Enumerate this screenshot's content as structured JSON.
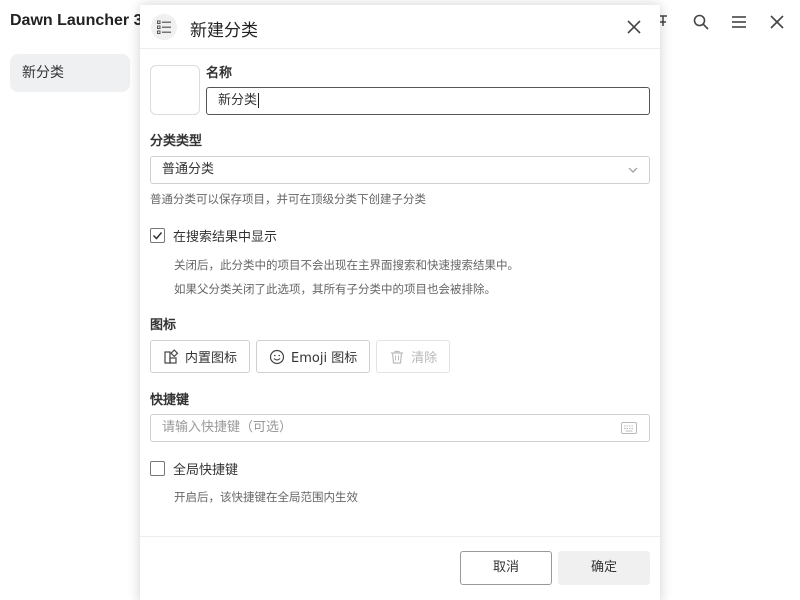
{
  "app": {
    "title": "Dawn Launcher 3",
    "sidebar_item": "新分类"
  },
  "dialog": {
    "title": "新建分类",
    "name_label": "名称",
    "name_value": "新分类",
    "type_label": "分类类型",
    "type_value": "普通分类",
    "type_help": "普通分类可以保存项目，并可在顶级分类下创建子分类",
    "show_in_search": {
      "label": "在搜索结果中显示",
      "checked": true,
      "help_1": "关闭后，此分类中的项目不会出现在主界面搜索和快速搜索结果中。",
      "help_2": "如果父分类关闭了此选项，其所有子分类中的项目也会被排除。"
    },
    "icon_label": "图标",
    "builtin_icon_button": "内置图标",
    "emoji_icon_button": "Emoji 图标",
    "clear_button": "清除",
    "shortcut_label": "快捷键",
    "shortcut_placeholder": "请输入快捷键（可选）",
    "global_shortcut": {
      "label": "全局快捷键",
      "checked": false,
      "help": "开启后，该快捷键在全局范围内生效"
    },
    "cancel_button": "取消",
    "ok_button": "确定"
  }
}
